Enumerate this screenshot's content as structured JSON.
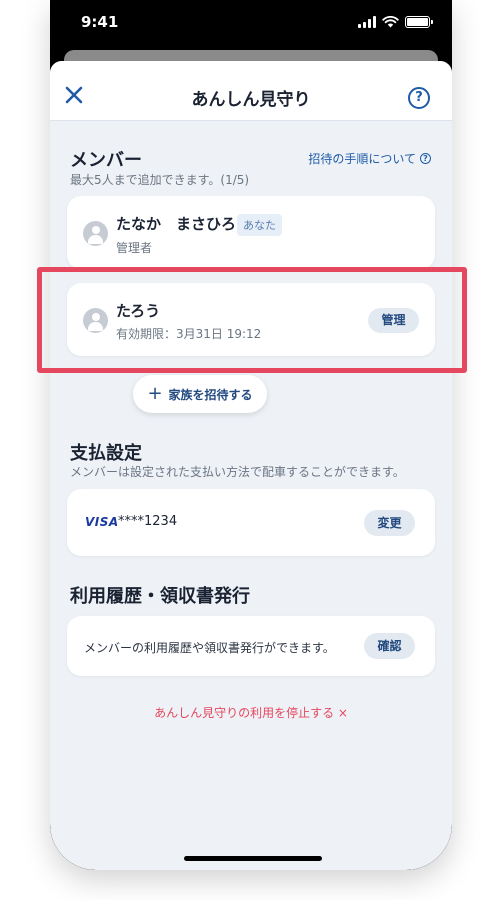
{
  "status_bar": {
    "time": "9:41"
  },
  "nav": {
    "title": "あんしん見守り",
    "help_icon": "?"
  },
  "members": {
    "title": "メンバー",
    "subtitle": "最大5人まで追加できます。(1/5)",
    "invite_steps_link": "招待の手順について",
    "list": [
      {
        "name": "たなか　まさひろ",
        "badge": "あなた",
        "role": "管理者"
      },
      {
        "name": "たろう",
        "expiry": "有効期限：3月31日 19:12",
        "action": "管理"
      }
    ],
    "invite_button": "家族を招待する"
  },
  "payment": {
    "title": "支払設定",
    "subtitle": "メンバーは設定された支払い方法で配車することができます。",
    "card_brand": "VISA",
    "card_number": "****1234",
    "change_button": "変更"
  },
  "history": {
    "title": "利用履歴・領収書発行",
    "description": "メンバーの利用履歴や領収書発行ができます。",
    "confirm_button": "確認"
  },
  "stop_service_link": "あんしん見守りの利用を停止する ×",
  "colors": {
    "accent": "#1f5ba7",
    "highlight": "#e5485e",
    "background": "#eef2f7"
  }
}
